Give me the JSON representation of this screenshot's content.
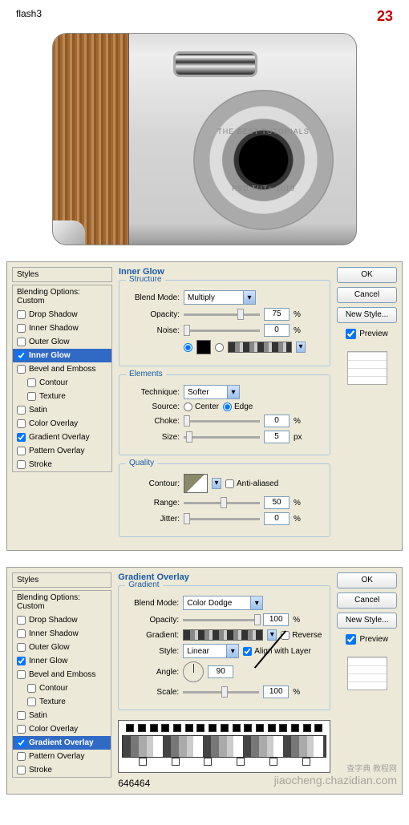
{
  "header": {
    "title": "flash3",
    "step": "23"
  },
  "camera": {
    "lens_top": "THE BEST TUTORIALS",
    "lens_bot": "PSD TUT+ 2010"
  },
  "styles_header": "Styles",
  "blending_options": "Blending Options: Custom",
  "style_items": [
    {
      "k": "drop_shadow",
      "label": "Drop Shadow",
      "checked": false
    },
    {
      "k": "inner_shadow",
      "label": "Inner Shadow",
      "checked": false
    },
    {
      "k": "outer_glow",
      "label": "Outer Glow",
      "checked": false
    },
    {
      "k": "inner_glow",
      "label": "Inner Glow",
      "checked": true
    },
    {
      "k": "bevel",
      "label": "Bevel and Emboss",
      "checked": false
    },
    {
      "k": "contour",
      "label": "Contour",
      "checked": false,
      "indent": true
    },
    {
      "k": "texture",
      "label": "Texture",
      "checked": false,
      "indent": true
    },
    {
      "k": "satin",
      "label": "Satin",
      "checked": false
    },
    {
      "k": "color_overlay",
      "label": "Color Overlay",
      "checked": false
    },
    {
      "k": "gradient_overlay",
      "label": "Gradient Overlay",
      "checked": true
    },
    {
      "k": "pattern_overlay",
      "label": "Pattern Overlay",
      "checked": false
    },
    {
      "k": "stroke",
      "label": "Stroke",
      "checked": false
    }
  ],
  "panel1": {
    "title": "Inner Glow",
    "structure": {
      "legend": "Structure",
      "blend_mode_l": "Blend Mode:",
      "blend_mode": "Multiply",
      "opacity_l": "Opacity:",
      "opacity": "75",
      "opacity_u": "%",
      "noise_l": "Noise:",
      "noise": "0",
      "noise_u": "%"
    },
    "elements": {
      "legend": "Elements",
      "technique_l": "Technique:",
      "technique": "Softer",
      "source_l": "Source:",
      "center": "Center",
      "edge": "Edge",
      "choke_l": "Choke:",
      "choke": "0",
      "choke_u": "%",
      "size_l": "Size:",
      "size": "5",
      "size_u": "px"
    },
    "quality": {
      "legend": "Quality",
      "contour_l": "Contour:",
      "aa": "Anti-aliased",
      "range_l": "Range:",
      "range": "50",
      "range_u": "%",
      "jitter_l": "Jitter:",
      "jitter": "0",
      "jitter_u": "%"
    }
  },
  "panel2": {
    "title": "Gradient Overlay",
    "gradient": {
      "legend": "Gradient",
      "blend_mode_l": "Blend Mode:",
      "blend_mode": "Color Dodge",
      "opacity_l": "Opacity:",
      "opacity": "100",
      "opacity_u": "%",
      "gradient_l": "Gradient:",
      "reverse": "Reverse",
      "style_l": "Style:",
      "style": "Linear",
      "align": "Align with Layer",
      "angle_l": "Angle:",
      "angle": "90",
      "scale_l": "Scale:",
      "scale": "100",
      "scale_u": "%"
    },
    "hex": "646464"
  },
  "buttons": {
    "ok": "OK",
    "cancel": "Cancel",
    "new_style": "New Style...",
    "preview": "Preview"
  },
  "watermark": {
    "l1": "查字典 教程网",
    "l2": "jiaocheng.chazidian.com"
  }
}
